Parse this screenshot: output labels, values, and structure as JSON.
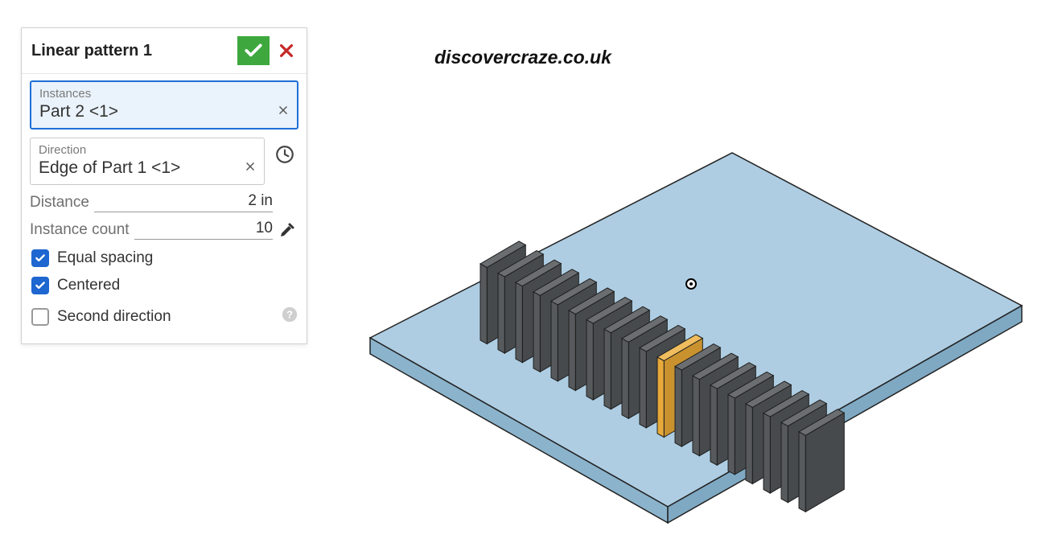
{
  "watermark": "discovercraze.co.uk",
  "panel": {
    "title": "Linear pattern 1",
    "instances": {
      "label": "Instances",
      "value": "Part 2 <1>"
    },
    "direction": {
      "label": "Direction",
      "value": "Edge of Part 1 <1>"
    },
    "distance": {
      "label": "Distance",
      "value": "2 in"
    },
    "count": {
      "label": "Instance count",
      "value": "10"
    },
    "equal_spacing": {
      "label": "Equal spacing",
      "checked": true
    },
    "centered": {
      "label": "Centered",
      "checked": true
    },
    "second_dir": {
      "label": "Second direction",
      "checked": false
    }
  },
  "icons": {
    "accept": "check",
    "cancel": "x",
    "clock": "clock",
    "dropper": "eyedropper",
    "help": "question"
  }
}
